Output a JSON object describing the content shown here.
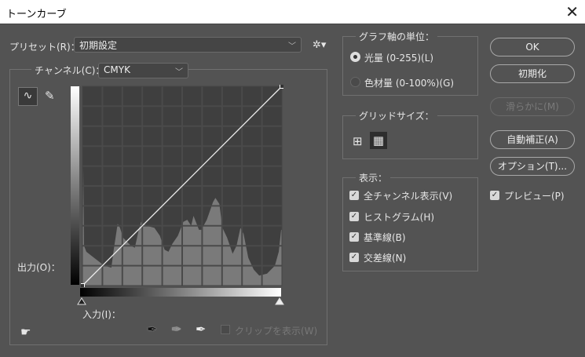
{
  "title": "トーンカーブ",
  "preset": {
    "label": "プリセット(R)：",
    "value": "初期設定"
  },
  "channel": {
    "label": "チャンネル(C)：",
    "value": "CMYK"
  },
  "output_label": "出力(O)：",
  "input_label": "入力(I)：",
  "clip": {
    "label": "クリップを表示(W)",
    "checked": false,
    "disabled": true
  },
  "axis_units": {
    "title": "グラフ軸の単位：",
    "options": [
      {
        "label": "光量 (0-255)(L)",
        "selected": true
      },
      {
        "label": "色材量 (0-100%)(G)",
        "selected": false
      }
    ]
  },
  "grid_size": {
    "title": "グリッドサイズ：",
    "selected": "fine"
  },
  "display": {
    "title": "表示：",
    "options": [
      {
        "label": "全チャンネル表示(V)",
        "checked": true
      },
      {
        "label": "ヒストグラム(H)",
        "checked": true
      },
      {
        "label": "基準線(B)",
        "checked": true
      },
      {
        "label": "交差線(N)",
        "checked": true
      }
    ]
  },
  "buttons": {
    "ok": "OK",
    "reset": "初期化",
    "smooth": "滑らかに(M)",
    "auto": "自動補正(A)",
    "options": "オプション(T)..."
  },
  "preview": {
    "label": "プレビュー(P)",
    "checked": true
  },
  "curve_points": [
    [
      0,
      0
    ],
    [
      255,
      255
    ]
  ],
  "histogram": [
    [
      1,
      0.59
    ],
    [
      2,
      0.2
    ],
    [
      5,
      0.17
    ],
    [
      18,
      0.13
    ],
    [
      28,
      0.1
    ],
    [
      37,
      0.09
    ],
    [
      40,
      0.18
    ],
    [
      45,
      0.31
    ],
    [
      48,
      0.29
    ],
    [
      52,
      0.24
    ],
    [
      62,
      0.2
    ],
    [
      67,
      0.19
    ],
    [
      72,
      0.28
    ],
    [
      75,
      0.32
    ],
    [
      82,
      0.3
    ],
    [
      92,
      0.29
    ],
    [
      99,
      0.25
    ],
    [
      105,
      0.18
    ],
    [
      110,
      0.17
    ],
    [
      115,
      0.21
    ],
    [
      122,
      0.25
    ],
    [
      129,
      0.32
    ],
    [
      134,
      0.33
    ],
    [
      139,
      0.3
    ],
    [
      142,
      0.35
    ],
    [
      149,
      0.28
    ],
    [
      152,
      0.28
    ],
    [
      159,
      0.33
    ],
    [
      167,
      0.42
    ],
    [
      170,
      0.44
    ],
    [
      175,
      0.41
    ],
    [
      179,
      0.29
    ],
    [
      185,
      0.24
    ],
    [
      192,
      0.16
    ],
    [
      197,
      0.2
    ],
    [
      202,
      0.29
    ],
    [
      206,
      0.26
    ],
    [
      212,
      0.14
    ],
    [
      219,
      0.08
    ],
    [
      226,
      0.05
    ],
    [
      236,
      0.06
    ],
    [
      246,
      0.1
    ],
    [
      251,
      0.17
    ],
    [
      254,
      0.28
    ]
  ]
}
